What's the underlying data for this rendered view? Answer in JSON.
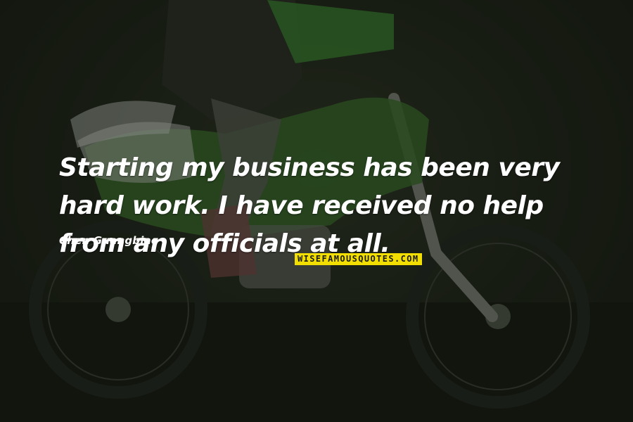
{
  "quote": {
    "text": "Starting my business has been very hard work. I have received no help from any officials at all.",
    "author": "Chen Guangbiao"
  },
  "watermark": {
    "text": "WISEFAMOUSQUOTES.COM",
    "color": "#f2de00"
  },
  "background": {
    "subject": "motocross-rider-on-green-dirt-bike",
    "dominant_colors": [
      "#1f251a",
      "#3fa23a",
      "#e6e6e6"
    ]
  }
}
